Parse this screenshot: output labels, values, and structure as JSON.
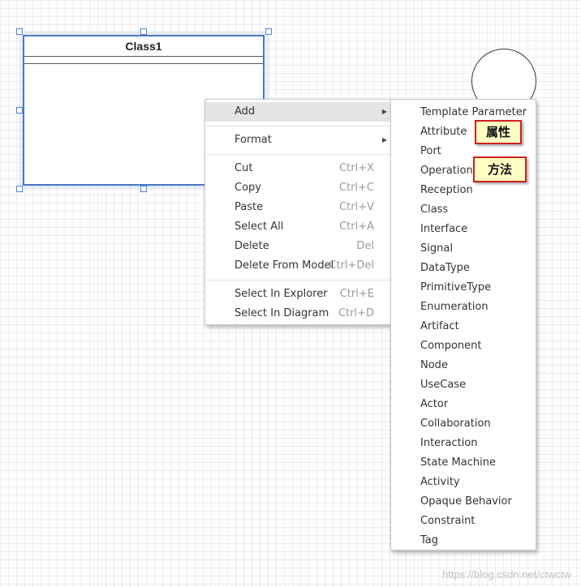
{
  "diagram": {
    "class_name": "Class1"
  },
  "main_menu": {
    "items": [
      {
        "label": "Add",
        "shortcut": "",
        "submenu": true
      },
      {
        "label": "Format",
        "shortcut": "",
        "submenu": true
      },
      {
        "label": "Cut",
        "shortcut": "Ctrl+X"
      },
      {
        "label": "Copy",
        "shortcut": "Ctrl+C"
      },
      {
        "label": "Paste",
        "shortcut": "Ctrl+V"
      },
      {
        "label": "Select All",
        "shortcut": "Ctrl+A"
      },
      {
        "label": "Delete",
        "shortcut": "Del"
      },
      {
        "label": "Delete From Model",
        "shortcut": "Ctrl+Del"
      },
      {
        "label": "Select In Explorer",
        "shortcut": "Ctrl+E"
      },
      {
        "label": "Select In Diagram",
        "shortcut": "Ctrl+D"
      }
    ],
    "submenu_arrow": "▶"
  },
  "add_submenu": {
    "items": [
      "Template Parameter",
      "Attribute",
      "Port",
      "Operation",
      "Reception",
      "Class",
      "Interface",
      "Signal",
      "DataType",
      "PrimitiveType",
      "Enumeration",
      "Artifact",
      "Component",
      "Node",
      "UseCase",
      "Actor",
      "Collaboration",
      "Interaction",
      "State Machine",
      "Activity",
      "Opaque Behavior",
      "Constraint",
      "Tag"
    ]
  },
  "annotations": {
    "attribute_note": "属性",
    "operation_note": "方法"
  },
  "watermark": "https://blog.csdn.net/ctwctw",
  "colors": {
    "selection": "#4a86d8",
    "class_border": "#4a79c0",
    "callout_border": "#d11e1e",
    "callout_fill": "#ffffc4",
    "menu_highlight": "#e5e5e5"
  }
}
